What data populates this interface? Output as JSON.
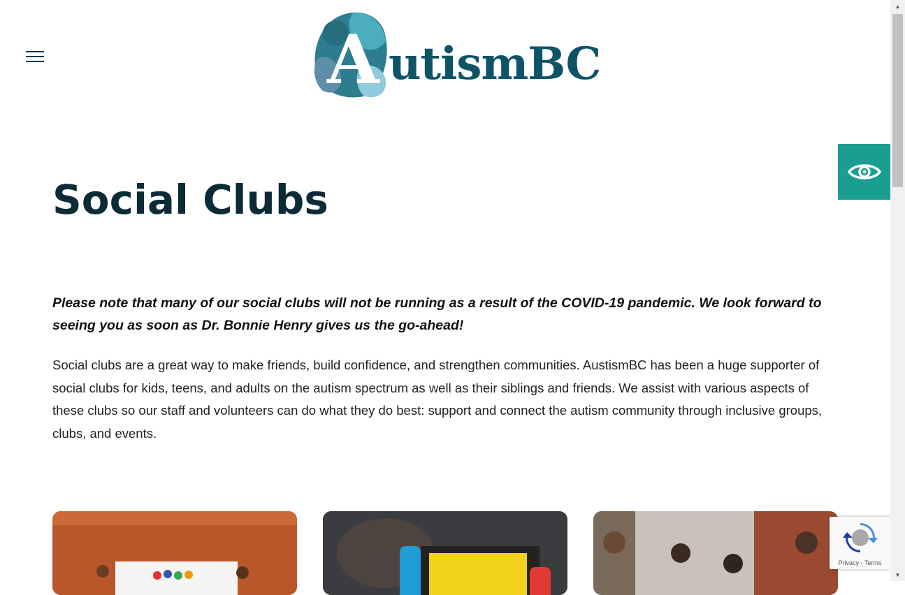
{
  "header": {
    "logo_text": "utismBC",
    "logo_initial": "A",
    "menu_icon": "hamburger-menu-icon"
  },
  "accessibility": {
    "icon": "eye-icon",
    "color": "#1a9e92"
  },
  "main": {
    "title": "Social Clubs",
    "notice": "Please note that many of our social clubs will not be running as a result of the COVID-19 pandemic. We look forward to seeing you as soon as Dr. Bonnie Henry gives us the go-ahead!",
    "body": "Social clubs are a great way to make friends, build confidence, and strengthen communities. AustismBC has been a huge supporter of social clubs for kids, teens, and adults on the autism spectrum as well as their siblings and friends. We assist with various aspects of these clubs so our staff and volunteers can do what they do best: support and connect the autism community through inclusive groups, clubs, and events."
  },
  "cards": [
    {
      "icon": "kids-with-banner-photo"
    },
    {
      "icon": "game-console-photo"
    },
    {
      "icon": "group-of-friends-photo"
    }
  ],
  "recaptcha": {
    "privacy": "Privacy",
    "separator": " - ",
    "terms": "Terms"
  },
  "colors": {
    "brand": "#0f5366",
    "title": "#0b2b36",
    "accent": "#1a9e92"
  }
}
